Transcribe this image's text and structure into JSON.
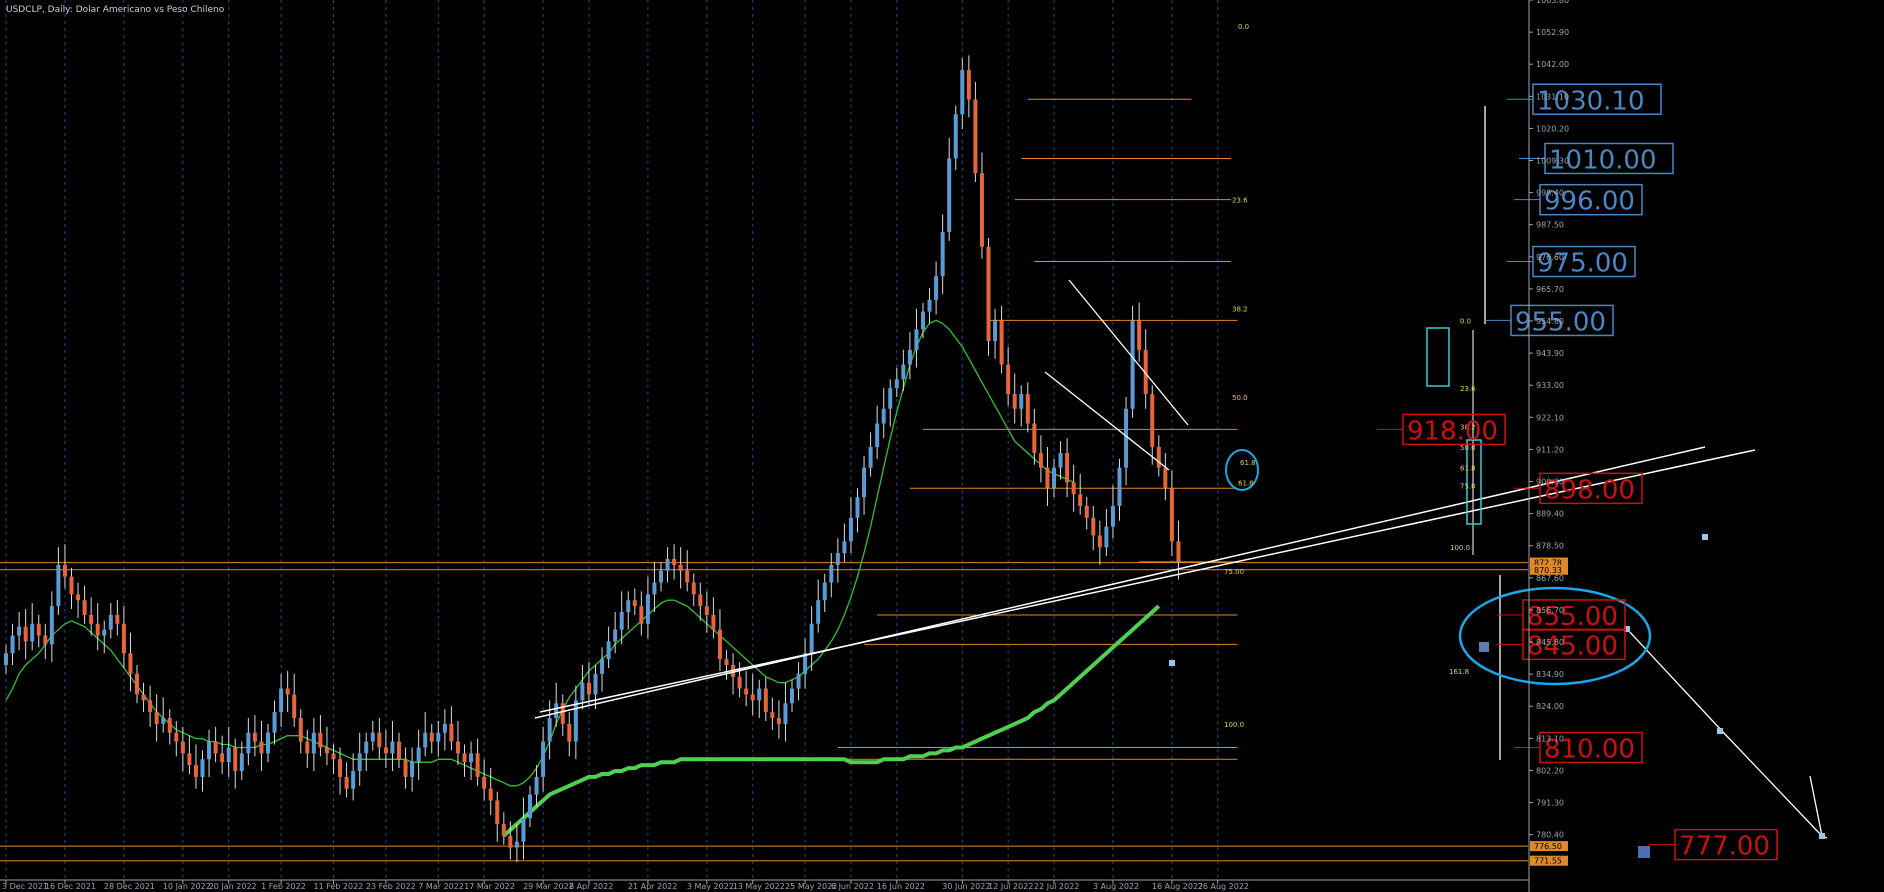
{
  "header": {
    "title": "USDCLP, Daily:  Dolar Americano vs Peso Chileno"
  },
  "colors": {
    "bull": "#5b9bd5",
    "bear": "#e8653a",
    "ma_fast": "#2ec22e",
    "ma_slow": "#4fd14f",
    "level": "#e0882a",
    "grid": "#1e4e88",
    "fib_text": "#e6d23a",
    "box_blue": "#4a86c4",
    "box_red": "#cc1010",
    "ellipse": "#19a7e8",
    "axis": "#9aa4b2"
  },
  "chart_data": {
    "type": "candlestick",
    "symbol": "USDCLP",
    "timeframe": "Daily",
    "ylim": [
      765,
      1063.8
    ],
    "y_ticks": [
      "1063.80",
      "1052.90",
      "1042.00",
      "1031.10",
      "1020.20",
      "1009.30",
      "998.40",
      "987.50",
      "976.60",
      "965.70",
      "954.80",
      "943.90",
      "933.00",
      "922.10",
      "911.20",
      "900.30",
      "889.40",
      "878.50",
      "867.60",
      "856.70",
      "845.80",
      "834.90",
      "824.00",
      "813.10",
      "802.20",
      "791.30",
      "780.40"
    ],
    "x_ticks": [
      "3 Dec 2021",
      "16 Dec 2021",
      "28 Dec 2021",
      "10 Jan 2022",
      "20 Jan 2022",
      "1 Feb 2022",
      "11 Feb 2022",
      "23 Feb 2022",
      "7 Mar 2022",
      "17 Mar 2022",
      "29 Mar 2022",
      "8 Apr 2022",
      "21 Apr 2022",
      "3 May 2022",
      "13 May 2022",
      "25 May 2022",
      "6 Jun 2022",
      "16 Jun 2022",
      "30 Jun 2022",
      "12 Jul 2022",
      "22 Jul 2022",
      "3 Aug 2022",
      "16 Aug 2022",
      "26 Aug 2022"
    ],
    "x_tick_index": [
      0,
      9,
      18,
      27,
      34,
      42,
      50,
      58,
      66,
      73,
      82,
      89,
      98,
      107,
      114,
      122,
      129,
      136,
      146,
      153,
      160,
      169,
      178,
      185
    ],
    "closes": [
      842,
      848,
      851,
      846,
      852,
      848,
      845,
      858,
      872,
      868,
      862,
      860,
      855,
      852,
      848,
      850,
      855,
      852,
      842,
      835,
      828,
      826,
      822,
      818,
      820,
      815,
      812,
      808,
      804,
      800,
      806,
      812,
      808,
      805,
      810,
      802,
      808,
      815,
      812,
      808,
      815,
      822,
      830,
      828,
      820,
      812,
      808,
      815,
      810,
      808,
      806,
      800,
      796,
      802,
      808,
      812,
      815,
      810,
      808,
      812,
      806,
      800,
      805,
      810,
      815,
      812,
      815,
      818,
      812,
      808,
      805,
      808,
      800,
      796,
      792,
      784,
      780,
      776,
      778,
      786,
      794,
      800,
      812,
      820,
      825,
      818,
      812,
      826,
      832,
      828,
      835,
      840,
      846,
      850,
      856,
      860,
      858,
      852,
      862,
      866,
      870,
      874,
      872,
      870,
      866,
      862,
      858,
      855,
      850,
      840,
      838,
      834,
      830,
      828,
      826,
      830,
      822,
      820,
      818,
      825,
      830,
      835,
      842,
      852,
      860,
      866,
      872,
      876,
      880,
      888,
      895,
      905,
      912,
      920,
      925,
      932,
      935,
      940,
      945,
      952,
      958,
      962,
      970,
      985,
      1010,
      1025,
      1040,
      1030,
      1005,
      980,
      948,
      955,
      940,
      930,
      925,
      930,
      920,
      910,
      905,
      898,
      905,
      910,
      900,
      896,
      892,
      888,
      882,
      878,
      885,
      892,
      905,
      925,
      955,
      945,
      930,
      912,
      905,
      898,
      880,
      873
    ],
    "opens_offset_note": "",
    "ma_fast_values": [
      826,
      830,
      835,
      838,
      840,
      842,
      845,
      848,
      850,
      852,
      853,
      852,
      851,
      849,
      847,
      845,
      843,
      840,
      837,
      834,
      831,
      828,
      825,
      822,
      820,
      818,
      816,
      815,
      814,
      813,
      813,
      812,
      812,
      811,
      811,
      810,
      810,
      810,
      810,
      811,
      811,
      812,
      813,
      814,
      814,
      814,
      813,
      812,
      811,
      810,
      809,
      808,
      807,
      806,
      806,
      806,
      806,
      806,
      806,
      806,
      806,
      806,
      805,
      805,
      805,
      805,
      806,
      806,
      806,
      805,
      804,
      803,
      802,
      801,
      800,
      799,
      798,
      797,
      797,
      798,
      800,
      803,
      807,
      812,
      818,
      823,
      827,
      830,
      833,
      836,
      838,
      840,
      842,
      845,
      847,
      849,
      851,
      853,
      855,
      857,
      859,
      860,
      860,
      859,
      858,
      856,
      854,
      852,
      850,
      848,
      846,
      844,
      842,
      840,
      838,
      836,
      834,
      833,
      832,
      832,
      833,
      834,
      836,
      838,
      840,
      843,
      846,
      850,
      855,
      861,
      868,
      876,
      885,
      895,
      905,
      915,
      924,
      932,
      940,
      946,
      951,
      954,
      955,
      954,
      952,
      949,
      946,
      942,
      938,
      934,
      930,
      926,
      922,
      918,
      914,
      912,
      910,
      908,
      906,
      904,
      903,
      902,
      901,
      900
    ],
    "ma_slow_values": [
      780,
      782,
      784,
      786,
      788,
      790,
      792,
      794,
      795,
      796,
      797,
      798,
      799,
      800,
      800,
      801,
      801,
      802,
      802,
      803,
      803,
      804,
      804,
      804,
      805,
      805,
      805,
      806,
      806,
      806,
      806,
      806,
      806,
      806,
      806,
      806,
      806,
      806,
      806,
      806,
      806,
      806,
      806,
      806,
      806,
      806,
      806,
      806,
      806,
      806,
      806,
      806,
      806,
      805,
      805,
      805,
      805,
      805,
      806,
      806,
      806,
      806,
      807,
      807,
      807,
      808,
      808,
      809,
      809,
      810,
      810,
      811,
      812,
      813,
      814,
      815,
      816,
      817,
      818,
      819,
      820,
      822,
      823,
      825,
      826,
      828,
      830,
      832,
      834,
      836,
      838,
      840,
      842,
      844,
      846,
      848,
      850,
      852,
      854,
      856,
      858
    ],
    "price_boxes": [
      {
        "label": "1030.10",
        "style": "blue",
        "price": 1030.1
      },
      {
        "label": "1010.00",
        "style": "blue",
        "price": 1010.0
      },
      {
        "label": "996.00",
        "style": "blue",
        "price": 996.0
      },
      {
        "label": "975.00",
        "style": "blue",
        "price": 975.0
      },
      {
        "label": "955.00",
        "style": "blue",
        "price": 955.0
      },
      {
        "label": "918.00",
        "style": "red",
        "price": 918.0
      },
      {
        "label": "898.00",
        "style": "red",
        "price": 898.0
      },
      {
        "label": "855.00",
        "style": "red",
        "price": 855.0
      },
      {
        "label": "845.00",
        "style": "red",
        "price": 845.0
      },
      {
        "label": "810.00",
        "style": "red",
        "price": 810.0
      },
      {
        "label": "777.00",
        "style": "red",
        "price": 777.0
      }
    ],
    "axis_markers": [
      {
        "label": "872.78",
        "price": 872.78,
        "style": "orange"
      },
      {
        "label": "870.33",
        "price": 870.33,
        "style": "orange"
      },
      {
        "label": "776.50",
        "price": 776.5,
        "style": "orange"
      },
      {
        "label": "771.55",
        "price": 771.55,
        "style": "orange"
      }
    ],
    "fib_labels": [
      {
        "text": "0.0",
        "price": 1055
      },
      {
        "text": "23.6",
        "price": 996
      },
      {
        "text": "38.2",
        "price": 959
      },
      {
        "text": "50.0",
        "price": 929
      },
      {
        "text": "61.8",
        "price": 900
      },
      {
        "text": "75.00",
        "price": 870
      },
      {
        "text": "100.0",
        "price": 818
      },
      {
        "text": "161.8",
        "price": 836
      },
      {
        "text": "0.0",
        "price": 955
      },
      {
        "text": "23.6",
        "price": 932
      },
      {
        "text": "38.2",
        "price": 919
      },
      {
        "text": "50.0",
        "price": 912
      },
      {
        "text": "61.8",
        "price": 905
      },
      {
        "text": "75.0",
        "price": 899
      },
      {
        "text": "100.0",
        "price": 878
      },
      {
        "text": "61.8",
        "price": 907
      }
    ]
  }
}
